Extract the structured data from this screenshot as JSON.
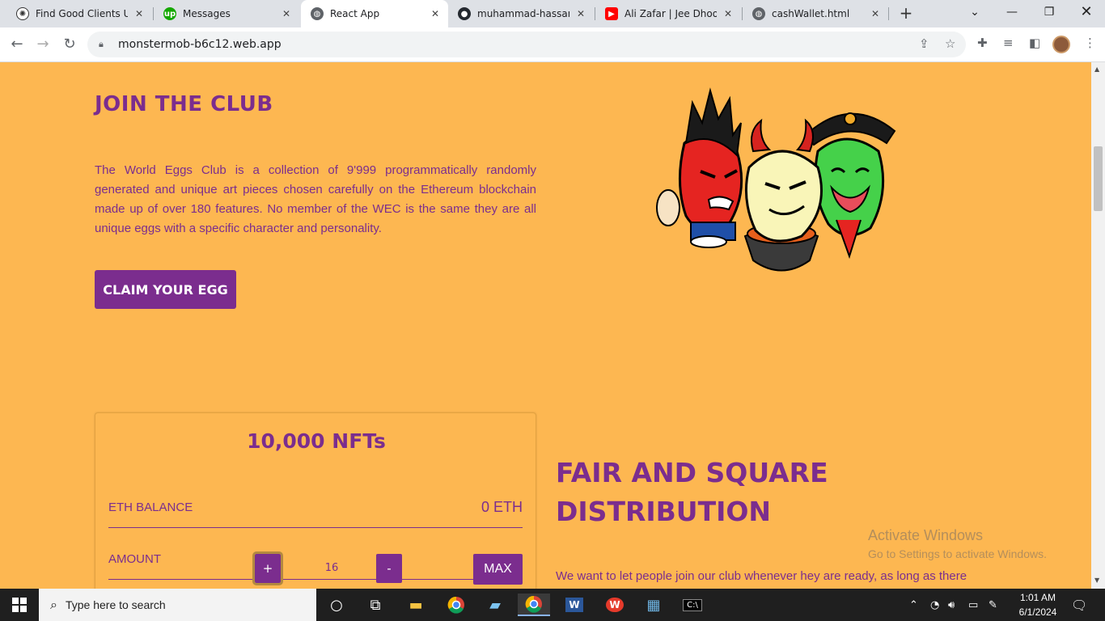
{
  "browser": {
    "tabs": [
      {
        "title": "Find Good Clients Upw",
        "icon": "chatgpt-icon"
      },
      {
        "title": "Messages",
        "icon": "upwork-icon"
      },
      {
        "title": "React App",
        "icon": "globe-icon",
        "active": true
      },
      {
        "title": "muhammad-hassan-n",
        "icon": "github-icon"
      },
      {
        "title": "Ali Zafar | Jee Dhoond",
        "icon": "youtube-icon"
      },
      {
        "title": "cashWallet.html",
        "icon": "globe-icon"
      }
    ],
    "url": "monstermob-b6c12.web.app"
  },
  "hero": {
    "title": "JOIN THE CLUB",
    "description": "The World Eggs Club is a collection of 9'999 programmatically randomly generated and unique art pieces chosen carefully on the Ethereum blockchain made up of over 180 features. No member of the WEC is the same they are all unique eggs with a specific character and personality.",
    "cta_label": "CLAIM YOUR EGG"
  },
  "mint_card": {
    "title": "10,000 NFTs",
    "balance_label": "ETH BALANCE",
    "balance_value": "0 ETH",
    "amount_label": "AMOUNT",
    "plus_label": "+",
    "minus_label": "-",
    "quantity": "16",
    "max_label": "MAX"
  },
  "distribution": {
    "title": "FAIR AND SQUARE DISTRIBUTION",
    "text": "We want to let people join our club whenever hey are ready, as long as there"
  },
  "watermark": {
    "line1": "Activate Windows",
    "line2": "Go to Settings to activate Windows."
  },
  "taskbar": {
    "search_placeholder": "Type here to search",
    "time": "1:01 AM",
    "date": "6/1/2024"
  },
  "colors": {
    "page_bg": "#fdb751",
    "accent": "#7b2d8e"
  }
}
